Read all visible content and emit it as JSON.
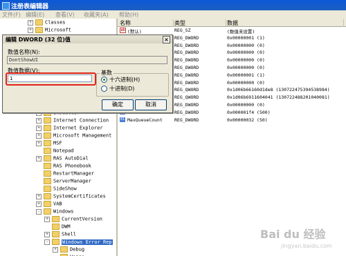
{
  "window": {
    "title": "注册表编辑器"
  },
  "menu": [
    "文件(F)",
    "编辑(E)",
    "查看(V)",
    "收藏夹(A)",
    "帮助(H)"
  ],
  "tree": [
    {
      "label": "Classes",
      "exp": "+"
    },
    {
      "label": "Microsoft",
      "exp": "+"
    },
    {
      "label": "Installer",
      "exp": "+"
    },
    {
      "label": "Internet Connection",
      "exp": "+"
    },
    {
      "label": "Internet Explorer",
      "exp": "+"
    },
    {
      "label": "Microsoft Management",
      "exp": "+"
    },
    {
      "label": "MSF",
      "exp": "+"
    },
    {
      "label": "Notepad",
      "exp": ""
    },
    {
      "label": "RAS AutoDial",
      "exp": "+"
    },
    {
      "label": "RAS Phonebook",
      "exp": ""
    },
    {
      "label": "RestartManager",
      "exp": ""
    },
    {
      "label": "ServerManager",
      "exp": ""
    },
    {
      "label": "SideShow",
      "exp": ""
    },
    {
      "label": "SystemCertificates",
      "exp": "+"
    },
    {
      "label": "VAB",
      "exp": "+"
    },
    {
      "label": "Windows",
      "exp": "-"
    },
    {
      "label": "CurrentVersion",
      "exp": "+"
    },
    {
      "label": "DWM",
      "exp": ""
    },
    {
      "label": "Shell",
      "exp": "+"
    },
    {
      "label": "Windows Error Rep",
      "exp": "-"
    },
    {
      "label": "Debug",
      "exp": "+"
    },
    {
      "label": "Hangs",
      "exp": ""
    }
  ],
  "list": {
    "headers": {
      "name": "名称",
      "type": "类型",
      "data": "数据"
    },
    "rows": [
      {
        "name": "(默认)",
        "type": "REG_SZ",
        "data": "(数值未设置)",
        "icon": "ab"
      },
      {
        "name": "",
        "type": "REG_DWORD",
        "data": "0x00000001 (1)",
        "icon": "bin"
      },
      {
        "name": "",
        "type": "REG_DWORD",
        "data": "0x00000000 (0)",
        "icon": "bin"
      },
      {
        "name": "",
        "type": "REG_DWORD",
        "data": "0x00000000 (0)",
        "icon": "bin"
      },
      {
        "name": "",
        "type": "REG_DWORD",
        "data": "0x00000000 (0)",
        "icon": "bin"
      },
      {
        "name": "",
        "type": "REG_DWORD",
        "data": "0x00000000 (0)",
        "icon": "bin"
      },
      {
        "name": "",
        "type": "REG_DWORD",
        "data": "0x00000001 (1)",
        "icon": "bin"
      },
      {
        "name": "",
        "type": "REG_DWORD",
        "data": "0x00000000 (0)",
        "icon": "bin"
      },
      {
        "name": "",
        "type": "REG_QWORD",
        "data": "0x1d06b66160d1de8 (130722475394538984)",
        "icon": "bin"
      },
      {
        "name": "",
        "type": "REG_QWORD",
        "data": "0x1d06b6911604041 (130722488201040081)",
        "icon": "bin"
      },
      {
        "name": "",
        "type": "REG_DWORD",
        "data": "0x00000000 (0)",
        "icon": "bin"
      },
      {
        "name": "",
        "type": "REG_DWORD",
        "data": "0x000001f4 (500)",
        "icon": "bin"
      },
      {
        "name": "MaxQueueCount",
        "type": "REG_DWORD",
        "data": "0x00000032 (50)",
        "icon": "bin"
      }
    ]
  },
  "dialog": {
    "title": "编辑 DWORD (32 位)值",
    "name_label": "数值名称(N):",
    "name_value": "DontShowUI",
    "data_label": "数值数据(V):",
    "data_value": "1",
    "base_label": "基数",
    "hex_label": "十六进制(H)",
    "dec_label": "十进制(D)",
    "ok": "确定",
    "cancel": "取消"
  },
  "watermark": {
    "logo": "Bai du 经验",
    "url": "jingyan.baidu.com"
  }
}
